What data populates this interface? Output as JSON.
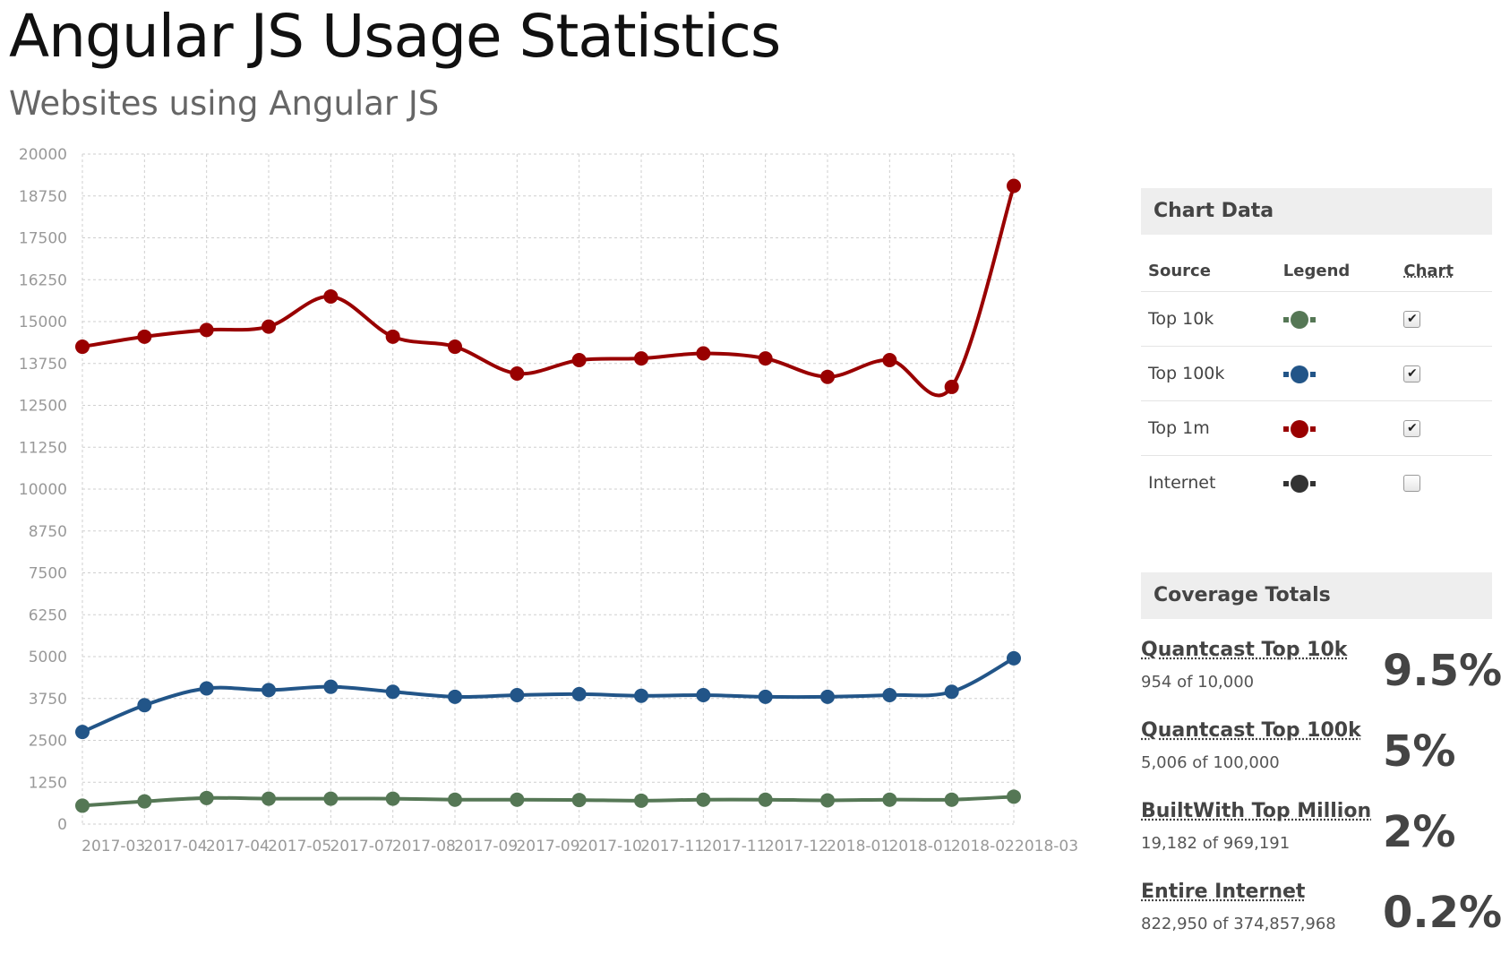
{
  "page": {
    "title": "Angular JS Usage Statistics",
    "subtitle": "Websites using Angular JS"
  },
  "chart_data": {
    "type": "line",
    "title": "",
    "xlabel": "",
    "ylabel": "",
    "ylim": [
      0,
      20000
    ],
    "yticks": [
      0,
      1250,
      2500,
      3750,
      5000,
      6250,
      7500,
      8750,
      10000,
      11250,
      12500,
      13750,
      15000,
      16250,
      17500,
      18750,
      20000
    ],
    "grid": true,
    "x": [
      "2017-03",
      "2017-04",
      "2017-04",
      "2017-05",
      "2017-07",
      "2017-08",
      "2017-09",
      "2017-09",
      "2017-10",
      "2017-11",
      "2017-11",
      "2017-12",
      "2018-01",
      "2018-01",
      "2018-02",
      "2018-03"
    ],
    "series": [
      {
        "name": "Top 1m",
        "color": "#990000",
        "values": [
          14250,
          14550,
          14750,
          14850,
          15750,
          14550,
          14250,
          13450,
          13850,
          13900,
          14050,
          13900,
          13350,
          13850,
          13050,
          19050
        ]
      },
      {
        "name": "Top 100k",
        "color": "#225588",
        "values": [
          2750,
          3550,
          4050,
          4000,
          4100,
          3950,
          3800,
          3850,
          3880,
          3830,
          3850,
          3800,
          3800,
          3850,
          3950,
          4950
        ]
      },
      {
        "name": "Top 10k",
        "color": "#557755",
        "values": [
          550,
          680,
          780,
          760,
          760,
          760,
          730,
          730,
          720,
          700,
          730,
          730,
          710,
          730,
          730,
          820
        ]
      }
    ]
  },
  "chart_panel": {
    "header": "Chart Data",
    "columns": [
      "Source",
      "Legend",
      "Chart"
    ],
    "rows": [
      {
        "source": "Top 10k",
        "color": "#557755",
        "checked": "✔"
      },
      {
        "source": "Top 100k",
        "color": "#225588",
        "checked": "✔"
      },
      {
        "source": "Top 1m",
        "color": "#990000",
        "checked": "✔"
      },
      {
        "source": "Internet",
        "color": "#333333",
        "checked": ""
      }
    ]
  },
  "coverage": {
    "header": "Coverage Totals",
    "items": [
      {
        "label": "Quantcast Top 10k",
        "detail": "954 of 10,000",
        "percent": "9.5%"
      },
      {
        "label": "Quantcast Top 100k",
        "detail": "5,006 of 100,000",
        "percent": "5%"
      },
      {
        "label": "BuiltWith Top Million",
        "detail": "19,182 of 969,191",
        "percent": "2%"
      },
      {
        "label": "Entire Internet",
        "detail": "822,950 of 374,857,968",
        "percent": "0.2%"
      }
    ]
  }
}
